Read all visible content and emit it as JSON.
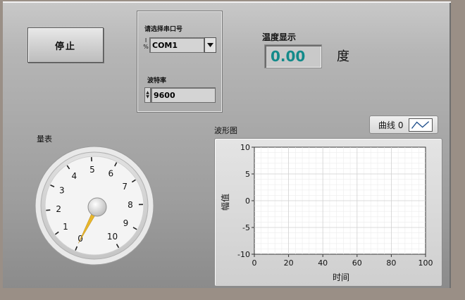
{
  "panel": {
    "stop_button_label": "停止",
    "temperature_label": "温度显示",
    "temperature_value": "0.00",
    "temperature_unit": "度"
  },
  "serial": {
    "port_label": "请选择串口号",
    "port_value": "COM1",
    "baud_label": "波特率",
    "baud_value": "9600"
  },
  "gauge": {
    "title": "量表",
    "ticks": [
      "0",
      "1",
      "2",
      "3",
      "4",
      "5",
      "6",
      "7",
      "8",
      "9",
      "10"
    ],
    "value": 0,
    "min": 0,
    "max": 10,
    "needle_color": "#e8b72a"
  },
  "waveform": {
    "title": "波形图",
    "legend_label": "曲线 0",
    "xlabel": "时间",
    "ylabel": "幅值",
    "x_ticks": [
      "0",
      "20",
      "40",
      "60",
      "80",
      "100"
    ],
    "y_ticks": [
      "10",
      "5",
      "0",
      "-5",
      "-10"
    ],
    "xlim": [
      0,
      100
    ],
    "ylim": [
      -10,
      10
    ],
    "grid": true,
    "line_color": "#1f4f8c"
  }
}
